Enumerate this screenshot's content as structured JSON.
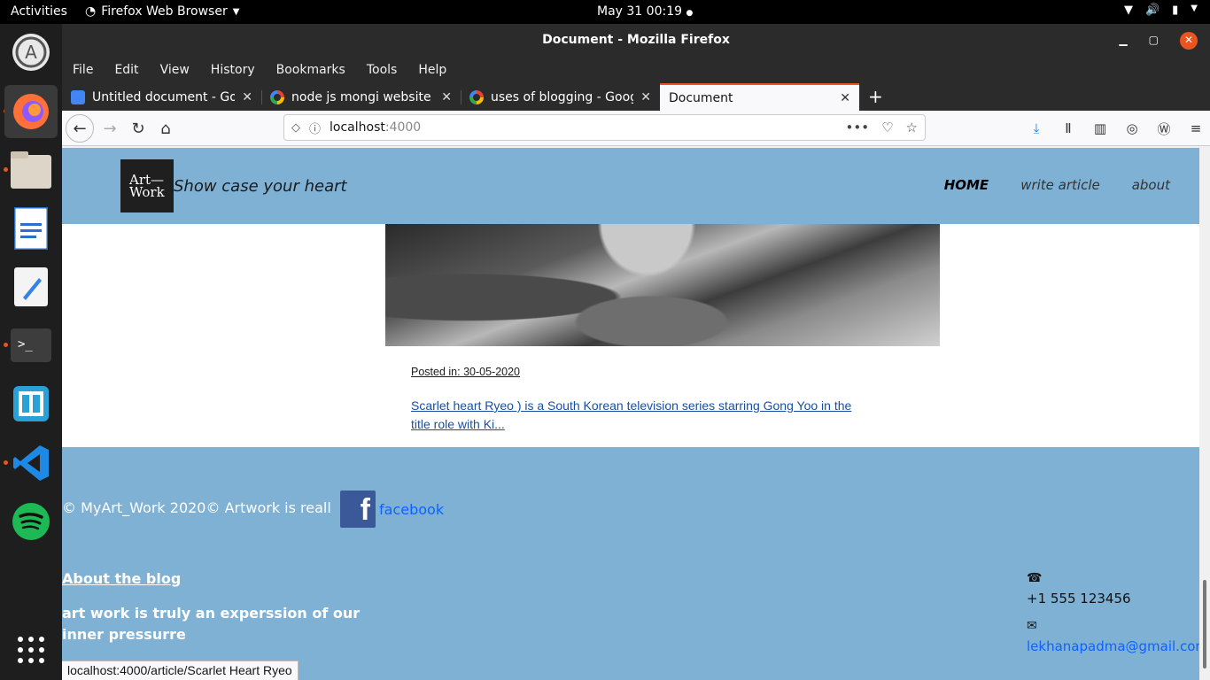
{
  "topbar": {
    "activities": "Activities",
    "app_name": "Firefox Web Browser",
    "clock": "May 31  00:19"
  },
  "dock": {
    "apps": [
      "ubuntu-software-icon",
      "firefox-icon",
      "files-icon",
      "libreoffice-writer-icon",
      "text-editor-icon",
      "terminal-icon",
      "app-icon",
      "vscode-icon",
      "spotify-icon",
      "show-apps-icon"
    ]
  },
  "window": {
    "title": "Document - Mozilla Firefox"
  },
  "menubar": {
    "items": [
      "File",
      "Edit",
      "View",
      "History",
      "Bookmarks",
      "Tools",
      "Help"
    ]
  },
  "tabs": [
    {
      "title": "Untitled document - Goo",
      "favicon": "google-docs-icon"
    },
    {
      "title": "node js mongi website w",
      "favicon": "google-icon"
    },
    {
      "title": "uses of blogging - Googl",
      "favicon": "google-icon"
    },
    {
      "title": "Document",
      "favicon": "none",
      "selected": true
    }
  ],
  "urlbar": {
    "host": "localhost",
    "port": ":4000"
  },
  "site": {
    "logo_line1": "Art—",
    "logo_line2": "Work",
    "tagline": "Show case your heart",
    "nav": [
      {
        "label": "HOME",
        "current": true
      },
      {
        "label": "write article",
        "current": false
      },
      {
        "label": "about",
        "current": false
      }
    ],
    "article": {
      "posted": "Posted in: 30-05-2020",
      "excerpt": "Scarlet heart Ryeo ) is a South Korean television series starring Gong Yoo in the title role with Ki..."
    },
    "footer": {
      "copyright": "© MyArt_Work 2020© Artwork is reall",
      "facebook_label": "facebook",
      "about_title": "About the blog",
      "about_text": "art work is truly an experssion of our inner pressurre",
      "phone": "+1 555 123456",
      "email": "lekhanapadma@gmail.com"
    }
  },
  "status": {
    "link": "localhost:4000/article/Scarlet Heart Ryeo"
  },
  "colors": {
    "accent": "#e95420",
    "header_bg": "#7fb1d5",
    "link": "#0d63ff"
  }
}
